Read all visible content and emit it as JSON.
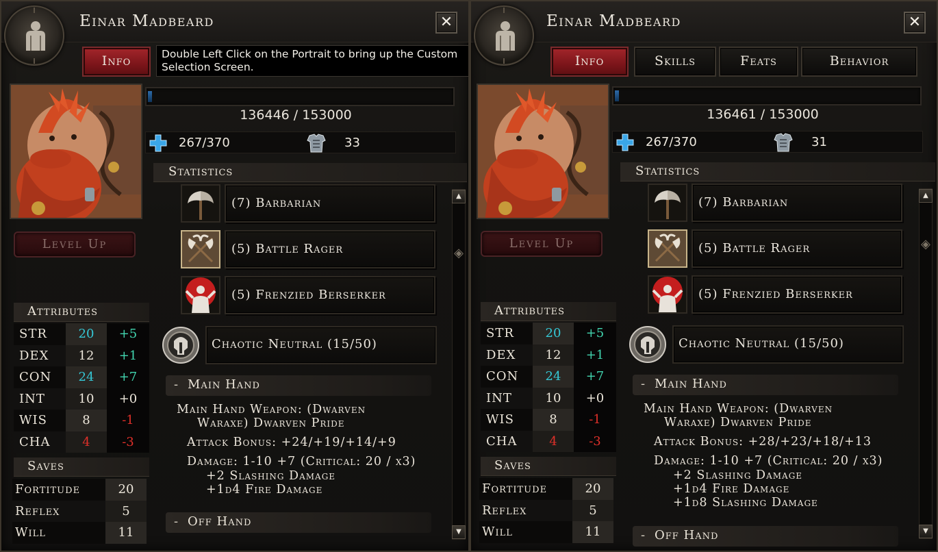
{
  "colors": {
    "accent_red": "#a3262b",
    "stat_cyan": "#35c8d6",
    "stat_green": "#42d6b0",
    "stat_red": "#e0302a",
    "stat_white": "#ece6da"
  },
  "panels": [
    {
      "name": "Einar Madbeard",
      "close_label": "✕",
      "tabs": [
        {
          "label": "Info",
          "active": true
        }
      ],
      "tooltip": {
        "line1": "Double Left Click on the Portrait to bring up the Custom",
        "line2": "Selection Screen."
      },
      "level_up_label": "Level Up",
      "xp": {
        "current": 136446,
        "max": 153000,
        "text": "136446 / 153000"
      },
      "hp": {
        "text": "267/370",
        "icon": "health-cross-icon"
      },
      "ac": {
        "text": "33",
        "icon": "armor-chest-icon"
      },
      "statistics_label": "Statistics",
      "classes": [
        {
          "label": "(7) Barbarian",
          "icon": "barbarian-axe-icon"
        },
        {
          "label": "(5) Battle Rager",
          "icon": "battle-rager-axes-icon"
        },
        {
          "label": "(5) Frenzied Berserker",
          "icon": "frenzied-berserker-icon"
        }
      ],
      "alignment": {
        "label": "Chaotic Neutral (15/50)",
        "icon": "alignment-helm-icon"
      },
      "main_hand": {
        "header": "Main Hand",
        "weapon_line1": "Main Hand Weapon: (Dwarven",
        "weapon_line2": "Waraxe) Dwarven Pride",
        "attack": "Attack Bonus: +24/+19/+14/+9",
        "damage": "Damage: 1-10 +7 (Critical: 20 / x3)",
        "extra": [
          "+2 Slashing Damage",
          "+1d4 Fire Damage"
        ]
      },
      "off_hand_header": "Off Hand",
      "attributes_label": "Attributes",
      "attributes": [
        {
          "name": "STR",
          "value": "20",
          "mod": "+5",
          "value_color": "cyan",
          "mod_color": "green"
        },
        {
          "name": "DEX",
          "value": "12",
          "mod": "+1",
          "value_color": "white",
          "mod_color": "green"
        },
        {
          "name": "CON",
          "value": "24",
          "mod": "+7",
          "value_color": "cyan",
          "mod_color": "green"
        },
        {
          "name": "INT",
          "value": "10",
          "mod": "+0",
          "value_color": "white",
          "mod_color": "white"
        },
        {
          "name": "WIS",
          "value": "8",
          "mod": "-1",
          "value_color": "white",
          "mod_color": "red"
        },
        {
          "name": "CHA",
          "value": "4",
          "mod": "-3",
          "value_color": "red",
          "mod_color": "red"
        }
      ],
      "saves_label": "Saves",
      "saves": [
        {
          "name": "Fortitude",
          "value": "20"
        },
        {
          "name": "Reflex",
          "value": "5"
        },
        {
          "name": "Will",
          "value": "11"
        }
      ]
    },
    {
      "name": "Einar Madbeard",
      "close_label": "✕",
      "tabs": [
        {
          "label": "Info",
          "active": true
        },
        {
          "label": "Skills",
          "active": false
        },
        {
          "label": "Feats",
          "active": false
        },
        {
          "label": "Behavior",
          "active": false
        }
      ],
      "level_up_label": "Level Up",
      "xp": {
        "current": 136461,
        "max": 153000,
        "text": "136461 / 153000"
      },
      "hp": {
        "text": "267/370",
        "icon": "health-cross-icon"
      },
      "ac": {
        "text": "31",
        "icon": "armor-chest-icon"
      },
      "statistics_label": "Statistics",
      "classes": [
        {
          "label": "(7) Barbarian",
          "icon": "barbarian-axe-icon"
        },
        {
          "label": "(5) Battle Rager",
          "icon": "battle-rager-axes-icon"
        },
        {
          "label": "(5) Frenzied Berserker",
          "icon": "frenzied-berserker-icon"
        }
      ],
      "alignment": {
        "label": "Chaotic Neutral (15/50)",
        "icon": "alignment-helm-icon"
      },
      "main_hand": {
        "header": "Main Hand",
        "weapon_line1": "Main Hand Weapon: (Dwarven",
        "weapon_line2": "Waraxe) Dwarven Pride",
        "attack": "Attack Bonus: +28/+23/+18/+13",
        "damage": "Damage: 1-10 +7 (Critical: 20 / x3)",
        "extra": [
          "+2 Slashing Damage",
          "+1d4 Fire Damage",
          "+1d8 Slashing Damage"
        ]
      },
      "off_hand_header": "Off Hand",
      "attributes_label": "Attributes",
      "attributes": [
        {
          "name": "STR",
          "value": "20",
          "mod": "+5",
          "value_color": "cyan",
          "mod_color": "green"
        },
        {
          "name": "DEX",
          "value": "12",
          "mod": "+1",
          "value_color": "white",
          "mod_color": "green"
        },
        {
          "name": "CON",
          "value": "24",
          "mod": "+7",
          "value_color": "cyan",
          "mod_color": "green"
        },
        {
          "name": "INT",
          "value": "10",
          "mod": "+0",
          "value_color": "white",
          "mod_color": "white"
        },
        {
          "name": "WIS",
          "value": "8",
          "mod": "-1",
          "value_color": "white",
          "mod_color": "red"
        },
        {
          "name": "CHA",
          "value": "4",
          "mod": "-3",
          "value_color": "red",
          "mod_color": "red"
        }
      ],
      "saves_label": "Saves",
      "saves": [
        {
          "name": "Fortitude",
          "value": "20"
        },
        {
          "name": "Reflex",
          "value": "5"
        },
        {
          "name": "Will",
          "value": "11"
        }
      ]
    }
  ]
}
